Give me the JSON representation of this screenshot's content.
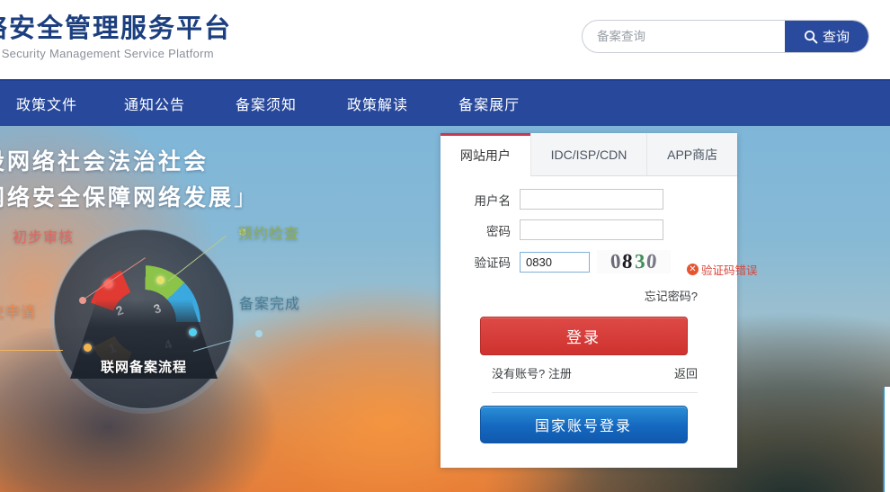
{
  "header": {
    "brand_cn": "网络安全管理服务平台",
    "brand_en": "Network Security Management Service Platform",
    "search": {
      "placeholder": "备案查询",
      "value": "",
      "button_label": "查询",
      "button_icon": "search-icon",
      "button_color": "#2a4a9e"
    }
  },
  "nav": {
    "background": "#27489b",
    "items": [
      {
        "label": "政策文件"
      },
      {
        "label": "通知公告"
      },
      {
        "label": "备案须知"
      },
      {
        "label": "政策解读"
      },
      {
        "label": "备案展厅"
      }
    ]
  },
  "banner": {
    "slogan_line1": "建设网络社会法治社会",
    "slogan_line2": "以网络安全保障网络发展",
    "slogan_bracket": "」",
    "infographic": {
      "caption": "联网备案流程",
      "steps": [
        {
          "num": "1",
          "label": "提交申请",
          "color": "#efa43a"
        },
        {
          "num": "2",
          "label": "初步审核",
          "color": "#e03a32"
        },
        {
          "num": "3",
          "label": "预约检查",
          "color": "#8cc44a"
        },
        {
          "num": "4",
          "label": "备案完成",
          "color": "#3aa9e0"
        }
      ]
    }
  },
  "login": {
    "tabs": [
      {
        "label": "网站用户",
        "active": true
      },
      {
        "label": "IDC/ISP/CDN",
        "active": false
      },
      {
        "label": "APP商店",
        "active": false
      }
    ],
    "active_tab_accent": "#c8384f",
    "fields": {
      "username_label": "用户名",
      "username_value": "",
      "password_label": "密码",
      "password_value": "",
      "captcha_label": "验证码",
      "captcha_value": "0830",
      "captcha_image_text": "0830"
    },
    "error": {
      "text": "验证码错误",
      "icon": "error-circle-icon",
      "color": "#d9453a"
    },
    "forgot_label": "忘记密码?",
    "login_button": "登录",
    "login_button_color": "#cf322f",
    "no_account_label": "没有账号?",
    "register_label": "注册",
    "back_label": "返回",
    "national_button": "国家账号登录",
    "national_button_color": "#1568c0"
  }
}
